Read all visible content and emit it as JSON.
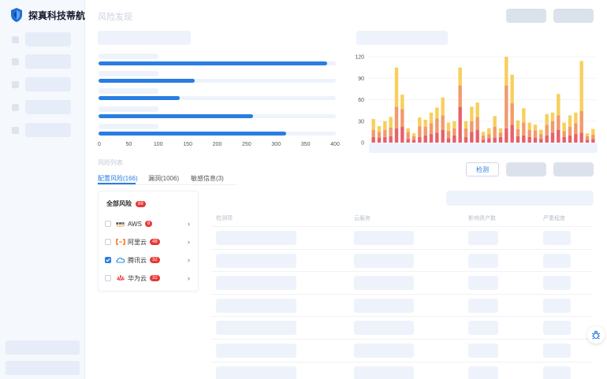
{
  "brand": {
    "name": "探真科技蒂航"
  },
  "header": {
    "title": "风险发现"
  },
  "top_chart": {
    "type": "bar",
    "orientation": "horizontal",
    "values": [
      385,
      162,
      137,
      260,
      316
    ],
    "xlim": [
      0,
      400
    ],
    "xticks": [
      "0",
      "50",
      "100",
      "150",
      "200",
      "250",
      "300",
      "350",
      "400"
    ],
    "color": "#2a7de1"
  },
  "chart_data": {
    "type": "bar",
    "stacked": true,
    "ylim": [
      0,
      120
    ],
    "yticks": [
      "0",
      "30",
      "60",
      "90",
      "120"
    ],
    "colors": [
      "#e8606a",
      "#f29a6b",
      "#f7cf5c"
    ],
    "series": [
      {
        "values": [
          8,
          7,
          8,
          9,
          20,
          22,
          5,
          4,
          8,
          10,
          12,
          14,
          18,
          6,
          10,
          50,
          8,
          15,
          18,
          4,
          6,
          7,
          8,
          20,
          25,
          9,
          10,
          8,
          7,
          5,
          10,
          14,
          18,
          8,
          10,
          12,
          14,
          4,
          5
        ]
      },
      {
        "values": [
          10,
          8,
          10,
          12,
          30,
          25,
          10,
          5,
          15,
          12,
          15,
          20,
          20,
          10,
          10,
          30,
          12,
          15,
          18,
          6,
          6,
          15,
          6,
          60,
          30,
          10,
          18,
          10,
          10,
          7,
          15,
          16,
          20,
          8,
          12,
          15,
          30,
          5,
          6
        ]
      },
      {
        "values": [
          15,
          8,
          12,
          15,
          55,
          20,
          5,
          4,
          12,
          10,
          15,
          15,
          25,
          12,
          10,
          25,
          10,
          20,
          20,
          5,
          8,
          15,
          6,
          40,
          40,
          12,
          20,
          10,
          8,
          6,
          15,
          12,
          30,
          12,
          16,
          15,
          70,
          4,
          8
        ]
      }
    ]
  },
  "risk_list": {
    "label": "风险列表",
    "tabs": [
      {
        "label": "配置风险(166)",
        "active": true
      },
      {
        "label": "漏洞(1006)",
        "active": false
      },
      {
        "label": "敏感信息(3)",
        "active": false
      }
    ],
    "panel": {
      "title": "全部风险",
      "count": "89",
      "providers": [
        {
          "name": "AWS",
          "count": "8",
          "checked": false,
          "icon": "aws-logo-icon"
        },
        {
          "name": "阿里云",
          "count": "48",
          "checked": false,
          "icon": "aliyun-logo-icon"
        },
        {
          "name": "腾讯云",
          "count": "32",
          "checked": true,
          "icon": "tencent-cloud-logo-icon"
        },
        {
          "name": "华为云",
          "count": "32",
          "checked": false,
          "icon": "huawei-cloud-logo-icon"
        }
      ]
    }
  },
  "actions": {
    "detect_label": "检测"
  },
  "table": {
    "columns": [
      "检测项",
      "云服务",
      "影响资产数",
      "严重程度"
    ]
  },
  "colors": {
    "accent": "#2a7de1",
    "badge": "#e53935"
  }
}
